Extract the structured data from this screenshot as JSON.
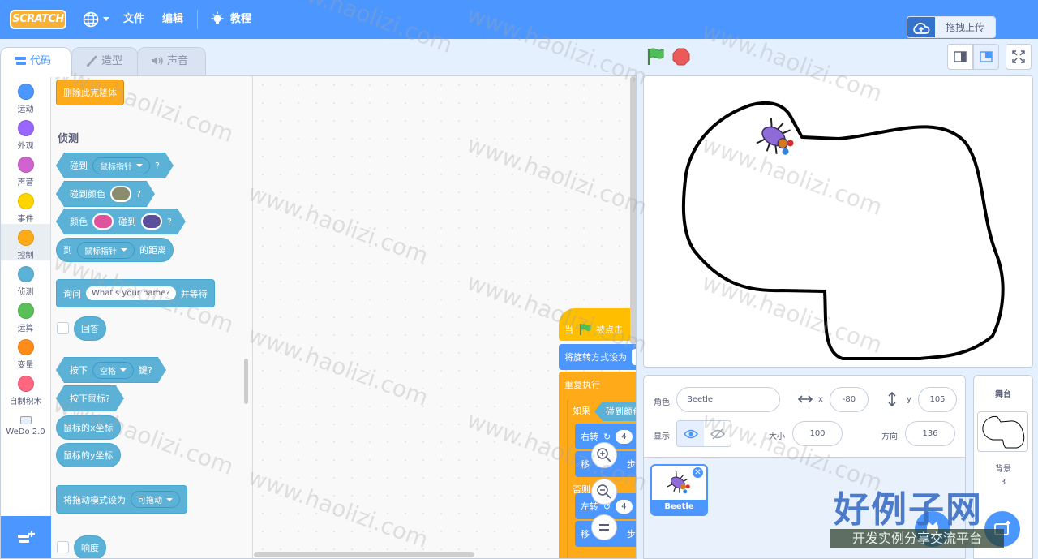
{
  "menubar": {
    "logo_text": "SCRATCH",
    "file": "文件",
    "edit": "编辑",
    "tutorials": "教程",
    "upload": "拖拽上传"
  },
  "tabs": {
    "code": "代码",
    "costumes": "造型",
    "sounds": "声音"
  },
  "categories": [
    {
      "label": "运动",
      "color": "#4c97ff"
    },
    {
      "label": "外观",
      "color": "#9966ff"
    },
    {
      "label": "声音",
      "color": "#cf63cf"
    },
    {
      "label": "事件",
      "color": "#ffd500"
    },
    {
      "label": "控制",
      "color": "#ffab19"
    },
    {
      "label": "侦测",
      "color": "#5cb1d6"
    },
    {
      "label": "运算",
      "color": "#59c059"
    },
    {
      "label": "变量",
      "color": "#ff8c1a"
    },
    {
      "label": "自制积木",
      "color": "#ff6680"
    },
    {
      "label": "WeDo 2.0",
      "color": ""
    }
  ],
  "palette": {
    "delete_clone": "删除此克隆体",
    "section_sensing": "侦测",
    "touching": "碰到",
    "mouse_pointer": "鼠标指针",
    "q": "?",
    "touching_color": "碰到颜色",
    "color": "颜色",
    "touches": "碰到",
    "distance_to": "到",
    "distance_suffix": "的距离",
    "ask": "询问",
    "ask_default": "What's your name?",
    "ask_wait": "并等待",
    "answer": "回答",
    "key_pressed_pre": "按下",
    "space": "空格",
    "key_suffix": "键?",
    "mouse_down": "按下鼠标?",
    "mouse_x": "鼠标的x坐标",
    "mouse_y": "鼠标的y坐标",
    "drag_mode": "将拖动模式设为",
    "draggable": "可拖动",
    "loudness": "响度",
    "swatch_colors": [
      "#8b8b6e",
      "#e0529c",
      "#5b4f9c"
    ]
  },
  "script": {
    "when": "当",
    "clicked": "被点击",
    "set_rotation": "将旋转方式设为",
    "forever": "重复执行",
    "if": "如果",
    "touching_color": "碰到颜色",
    "turn_right": "右转",
    "move": "移",
    "steps": "步",
    "else": "否则",
    "turn_left": "左转",
    "num": "4"
  },
  "sprite_info": {
    "sprite_label": "角色",
    "sprite_name": "Beetle",
    "x_label": "x",
    "x": "-80",
    "y_label": "y",
    "y": "105",
    "show_label": "显示",
    "size_label": "大小",
    "size": "100",
    "direction_label": "方向",
    "direction": "136"
  },
  "sprites": [
    {
      "name": "Beetle"
    }
  ],
  "stage_pane": {
    "title": "舞台",
    "backdrops_label": "背景",
    "backdrops_count": "3"
  },
  "watermark": {
    "text": "www.haolizi.com",
    "brand": "好例子网",
    "brand_sub": "开发实例分享交流平台"
  }
}
